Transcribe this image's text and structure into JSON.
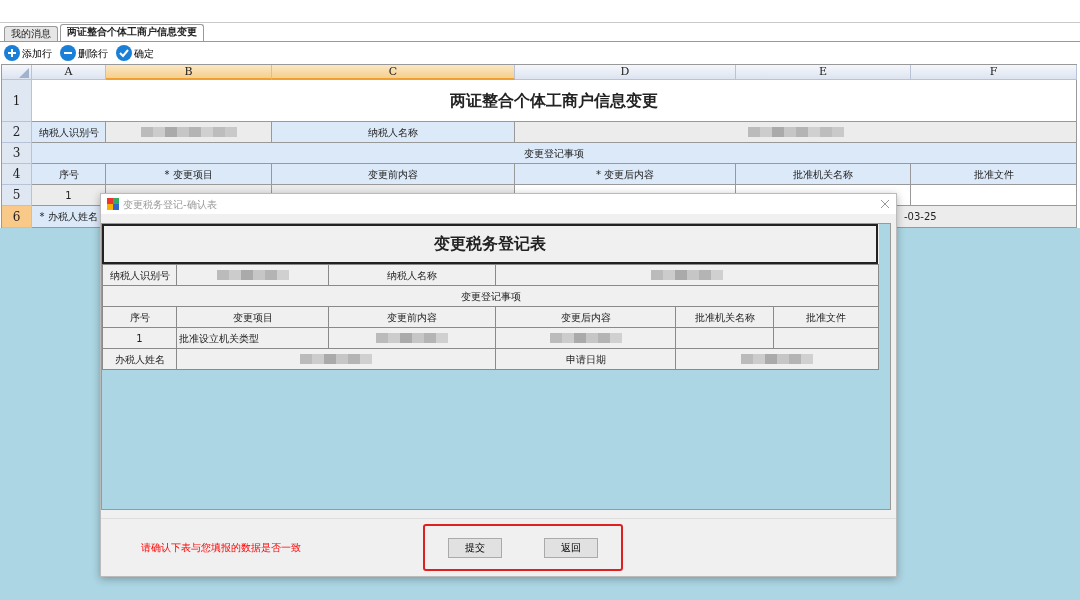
{
  "tabs": [
    {
      "label": "我的消息",
      "selected": false
    },
    {
      "label": "两证整合个体工商户信息变更",
      "selected": true
    }
  ],
  "toolbar": [
    {
      "label": "添加行",
      "kind": "add"
    },
    {
      "label": "删除行",
      "kind": "remove"
    },
    {
      "label": "确定",
      "kind": "confirm"
    }
  ],
  "sheet": {
    "columns": [
      {
        "label": "A",
        "selected": false
      },
      {
        "label": "B",
        "selected": true
      },
      {
        "label": "C",
        "selected": true
      },
      {
        "label": "D",
        "selected": false
      },
      {
        "label": "E",
        "selected": false
      },
      {
        "label": "F",
        "selected": false
      }
    ],
    "rows": [
      {
        "label": "1",
        "selected": false,
        "cells": [
          {
            "kind": "title",
            "text": "两证整合个体工商户信息变更"
          },
          "",
          "",
          "",
          "",
          ""
        ]
      },
      {
        "label": "2",
        "selected": false,
        "cells": [
          {
            "kind": "label",
            "text": "纳税人识别号"
          },
          {
            "kind": "picture"
          },
          {
            "kind": "label",
            "text": "纳税人名称"
          },
          {
            "kind": "picture"
          },
          "",
          ""
        ]
      },
      {
        "label": "3",
        "selected": false,
        "cells": [
          {
            "kind": "section",
            "text": "变更登记事项"
          },
          "",
          "",
          "",
          "",
          ""
        ]
      },
      {
        "label": "4",
        "selected": false,
        "cells": [
          {
            "kind": "label",
            "text": "序号"
          },
          {
            "kind": "label",
            "text": "* 变更项目"
          },
          {
            "kind": "label",
            "text": "变更前内容"
          },
          {
            "kind": "label",
            "text": "* 变更后内容"
          },
          {
            "kind": "label",
            "text": "批准机关名称"
          },
          {
            "kind": "label",
            "text": "批准文件"
          }
        ]
      },
      {
        "label": "5",
        "selected": false,
        "cells": [
          {
            "kind": "value",
            "text": "1"
          },
          {
            "kind": "value"
          },
          {
            "kind": "value"
          },
          {
            "kind": "blank"
          },
          {
            "kind": "blank"
          },
          {
            "kind": "blank"
          }
        ]
      },
      {
        "label": "6",
        "selected": true,
        "cells": [
          {
            "kind": "label",
            "text": "* 办税人姓名"
          },
          "",
          "",
          "",
          {
            "kind": "date",
            "text": "-03-25"
          },
          ""
        ]
      }
    ]
  },
  "dialog": {
    "title": "变更税务登记-确认表",
    "form": {
      "title": "变更税务登记表",
      "rows": [
        [
          "纳税人识别号",
          {
            "kind": "picture"
          },
          "纳税人名称",
          {
            "kind": "picture"
          },
          "",
          ""
        ],
        [
          "变更登记事项",
          "",
          "",
          "",
          "",
          ""
        ],
        [
          "序号",
          "变更项目",
          "变更前内容",
          "变更后内容",
          "批准机关名称",
          "批准文件"
        ],
        [
          "1",
          "批准设立机关类型",
          {
            "kind": "picture"
          },
          {
            "kind": "picture"
          },
          "",
          ""
        ],
        [
          "办税人姓名",
          {
            "kind": "picture"
          },
          "",
          "申请日期",
          {
            "kind": "picture"
          },
          ""
        ]
      ]
    },
    "message": "请确认下表与您填报的数据是否一致",
    "buttons": [
      "提交",
      "返回"
    ]
  }
}
